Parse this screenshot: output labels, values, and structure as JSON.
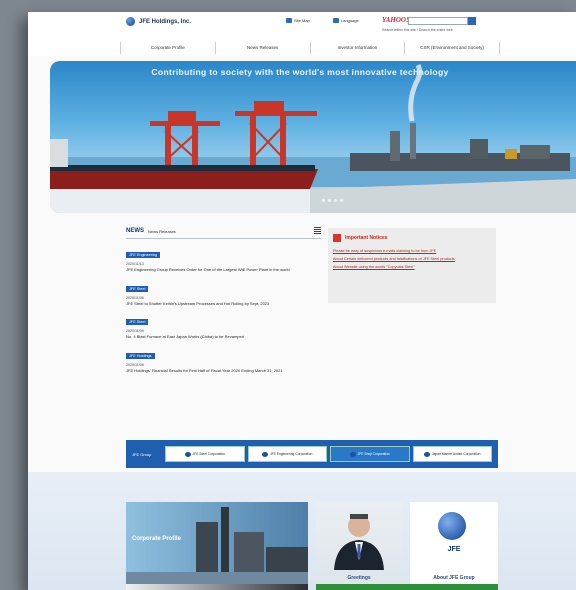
{
  "header": {
    "logo_text": "JFE Holdings, Inc.",
    "util_links": [
      "Site Map",
      "Language"
    ],
    "search_brand": "YAHOO!",
    "search_note": "Search within this site / Search the entire web",
    "nav": [
      "Corporate Profile",
      "News Releases",
      "Investor Information",
      "CSR (Environment and Society)"
    ]
  },
  "hero": {
    "title": "Contributing to society with the world's most innovative technology"
  },
  "news": {
    "title": "NEWS",
    "subtitle": "News Releases",
    "items": [
      {
        "badge": "JFE Engineering",
        "date": "2020/11/13",
        "title": "JFE Engineering Group Receives Order for One of the Largest WtE Power Plant in the world"
      },
      {
        "badge": "JFE Steel",
        "date": "2020/11/06",
        "title": "JFE Steel to Shutter Keihin's Upstream Processes and Hot Rolling by Sept. 2023"
      },
      {
        "badge": "JFE Steel",
        "date": "2020/11/09",
        "title": "No. 4 Blast Furnace at East Japan Works (Chiba) to be Revamped"
      },
      {
        "badge": "JFE Holdings",
        "date": "2020/11/06",
        "title": "JFE Holdings' Financial Results for First Half of Fiscal Year 2020 Ending March 31, 2021"
      }
    ]
  },
  "notices": {
    "title": "Important Notices",
    "links": [
      "Please be wary of suspicious e-mails claiming to be from JFE",
      "About Certain delivered products and falsifications of JFE Steel products",
      "About Website using the words \"Copycats Steel\""
    ]
  },
  "group": {
    "label": "JFE Group",
    "companies": [
      "JFE Steel Corporation",
      "JFE Engineering Corporation",
      "JFE Shoji Corporation",
      "Japan Marine United Corporation"
    ]
  },
  "cards": {
    "corporate_profile": "Corporate Profile",
    "greetings": "Greetings",
    "about_group": "About JFE Group",
    "logo_word": "JFE"
  }
}
